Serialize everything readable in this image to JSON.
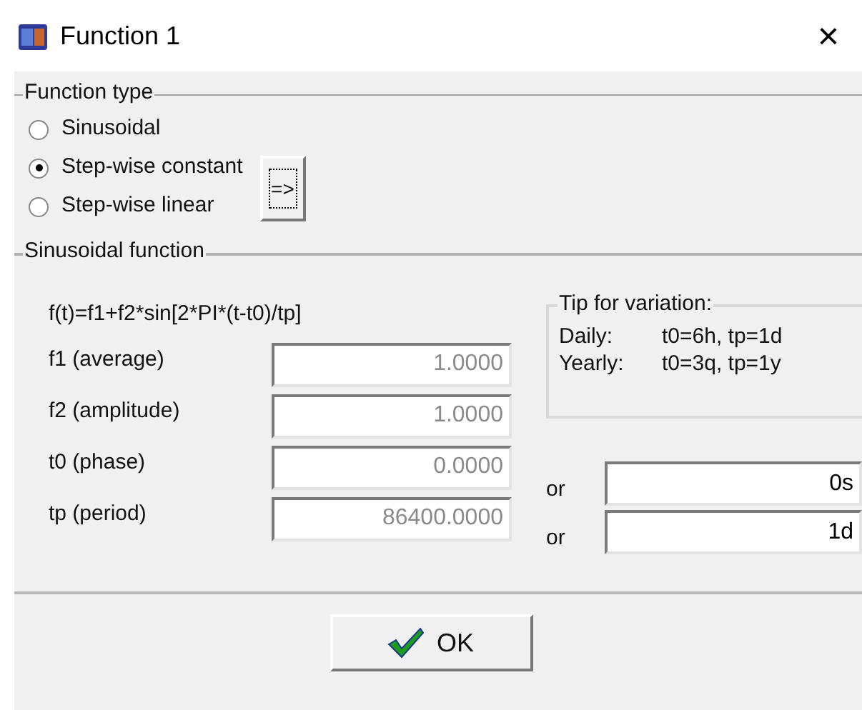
{
  "window": {
    "title": "Function 1",
    "close": "×"
  },
  "function_type": {
    "title": "Function type",
    "options": [
      {
        "label": "Sinusoidal",
        "selected": false
      },
      {
        "label": "Step-wise constant",
        "selected": true
      },
      {
        "label": "Step-wise linear",
        "selected": false
      }
    ],
    "edit_button": "=>"
  },
  "sinusoidal": {
    "title": "Sinusoidal function",
    "formula": "f(t)=f1+f2*sin[2*PI*(t-t0)/tp]",
    "tip": {
      "title": "Tip for variation:",
      "rows": [
        {
          "label": "Daily:",
          "value": "t0=6h, tp=1d"
        },
        {
          "label": "Yearly:",
          "value": "t0=3q, tp=1y"
        }
      ]
    },
    "params": [
      {
        "label": "f1 (average)",
        "value": "1.0000",
        "disabled": true
      },
      {
        "label": "f2 (amplitude)",
        "value": "1.0000",
        "disabled": true
      },
      {
        "label": "t0 (phase)",
        "value": "0.0000",
        "disabled": true,
        "or": "or",
        "alt_value": "0s",
        "alt_disabled": false
      },
      {
        "label": "tp (period)",
        "value": "86400.0000",
        "disabled": true,
        "or": "or",
        "alt_value": "1d",
        "alt_disabled": false
      }
    ]
  },
  "ok_button": "OK"
}
